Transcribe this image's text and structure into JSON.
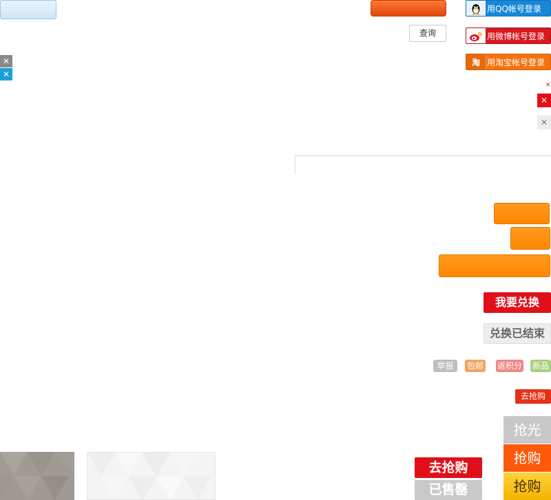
{
  "search": {
    "query_label": "查询"
  },
  "login": {
    "qq_label": "用QQ帐号登录",
    "weibo_label": "用微博帐号登录",
    "taobao_label": "用淘宝帐号登录",
    "taobao_icon_char": "淘"
  },
  "close_glyph": "✕",
  "exchange": {
    "redeem_label": "我要兑换",
    "ended_label": "兑换已结束"
  },
  "tags": {
    "report": "举报",
    "free_shipping": "包邮",
    "points_back": "返积分",
    "new_item": "新品"
  },
  "buy": {
    "go_grab_small": "去抢购",
    "sold_out_label": "抢光",
    "grab_label": "抢购",
    "grab_label_alt": "抢购",
    "go_grab_big": "去抢购",
    "sold_out_big": "已售罄"
  },
  "colors": {
    "accent_orange": "#ff8600",
    "accent_red": "#e10f19",
    "qq_blue": "#1987d8"
  }
}
